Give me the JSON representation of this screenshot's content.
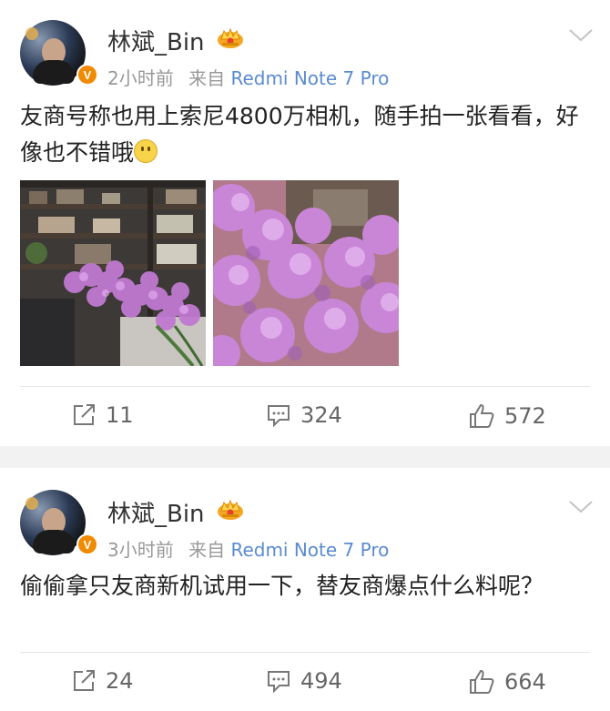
{
  "posts": [
    {
      "username": "林斌_Bin",
      "verified_badge": "V",
      "time": "2小时前",
      "source_prefix": "来自",
      "source": "Redmi Note 7 Pro",
      "text": "友商号称也用上索尼4800万相机，随手拍一张看看，好像也不错哦",
      "emoji": "smiley-icon",
      "images": [
        "flowers-bookshelf-photo",
        "flowers-closeup-photo"
      ],
      "reposts": "11",
      "comments": "324",
      "likes": "572"
    },
    {
      "username": "林斌_Bin",
      "verified_badge": "V",
      "time": "3小时前",
      "source_prefix": "来自",
      "source": "Redmi Note 7 Pro",
      "text": "偷偷拿只友商新机试用一下，替友商爆点什么料呢？",
      "reposts": "24",
      "comments": "494",
      "likes": "664"
    }
  ],
  "colors": {
    "source_link": "#5b8bd0",
    "meta_gray": "#999999",
    "verified_orange": "#f08a00",
    "separator": "#f2f2f2"
  }
}
